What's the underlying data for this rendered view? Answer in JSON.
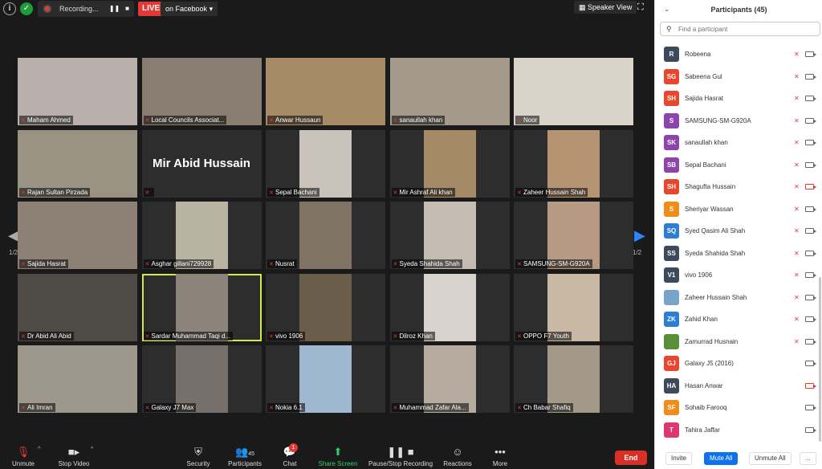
{
  "topbar": {
    "recording_label": "Recording...",
    "live_label": "LIVE",
    "live_target": "on Facebook",
    "speaker_view": "Speaker View"
  },
  "grid": {
    "page_indicator": "1/2",
    "big_name": "Mir Abid Hussain",
    "tiles": [
      {
        "name": "Maham Ahmed",
        "bg": "#b9b0ad"
      },
      {
        "name": "Local Councils Associat...",
        "bg": "#8a7d72"
      },
      {
        "name": "Anwar Hussaun",
        "bg": "#a78a66"
      },
      {
        "name": "sanaullah khan",
        "bg": "#a49a8c"
      },
      {
        "name": "Noor",
        "bg": "#d9d3c9"
      },
      {
        "name": "Rajan Sultan Pirzada",
        "bg": "#9a9384"
      },
      {
        "name": "",
        "bg": "#262626"
      },
      {
        "name": "Sepal Bachani",
        "bg": "#c9c3bc"
      },
      {
        "name": "Mir Ashraf Ali khan",
        "bg": "#a58a68"
      },
      {
        "name": "Zaheer Hussain Shah",
        "bg": "#b59474"
      },
      {
        "name": "Sajida Hasrat",
        "bg": "#8d8175"
      },
      {
        "name": "Asghar gillani729928",
        "bg": "#b9b3a4"
      },
      {
        "name": "Nusrat",
        "bg": "#7f7464"
      },
      {
        "name": "Syeda Shahida Shah",
        "bg": "#c5bcb1"
      },
      {
        "name": "SAMSUNG-SM-G920A",
        "bg": "#b79a84"
      },
      {
        "name": "Dr Abid Ali Abid",
        "bg": "#4e4a46"
      },
      {
        "name": "Sardar Muhammad Taqi d...",
        "bg": "#8c847a"
      },
      {
        "name": "vivo 1906",
        "bg": "#6a5d4a"
      },
      {
        "name": "Dilroz Khan",
        "bg": "#d8d3cc"
      },
      {
        "name": "OPPO F7 Youth",
        "bg": "#c9b8a4"
      },
      {
        "name": "Ali Imran",
        "bg": "#9e978c"
      },
      {
        "name": "Galaxy J7 Max",
        "bg": "#77706a"
      },
      {
        "name": "Nokia 6.1",
        "bg": "#9fb7cf"
      },
      {
        "name": "Muhammad Zafar Ala...",
        "bg": "#b6ab9f"
      },
      {
        "name": "Ch Babar Shafiq",
        "bg": "#a39989"
      }
    ]
  },
  "toolbar": {
    "unmute": "Unmute",
    "stop_video": "Stop Video",
    "security": "Security",
    "participants": "Participants",
    "participants_count": "45",
    "chat": "Chat",
    "chat_badge": "1",
    "share_screen": "Share Screen",
    "pause_stop_recording": "Pause/Stop Recording",
    "reactions": "Reactions",
    "more": "More",
    "end": "End"
  },
  "panel": {
    "title": "Participants (45)",
    "search_placeholder": "Find a participant",
    "invite": "Invite",
    "mute_all": "Mute All",
    "unmute_all": "Unmute All",
    "more": "...",
    "participants": [
      {
        "initials": "R",
        "name": "Robeena",
        "color": "#3c4a5c",
        "muted": true,
        "video_off": false
      },
      {
        "initials": "SG",
        "name": "Sabeena Gul",
        "color": "#e8472d",
        "muted": true,
        "video_off": false
      },
      {
        "initials": "SH",
        "name": "Sajida Hasrat",
        "color": "#e8472d",
        "muted": true,
        "video_off": false
      },
      {
        "initials": "S",
        "name": "SAMSUNG-SM-G920A",
        "color": "#8e44ad",
        "muted": true,
        "video_off": false
      },
      {
        "initials": "SK",
        "name": "sanaullah khan",
        "color": "#8e44ad",
        "muted": true,
        "video_off": false
      },
      {
        "initials": "SB",
        "name": "Sepal Bachani",
        "color": "#8e44ad",
        "muted": true,
        "video_off": false
      },
      {
        "initials": "SH",
        "name": "Shagufta Hussain",
        "color": "#e8472d",
        "muted": true,
        "video_off": true
      },
      {
        "initials": "S",
        "name": "Sheriyar Wassan",
        "color": "#f08c1a",
        "muted": true,
        "video_off": false
      },
      {
        "initials": "SQ",
        "name": "Syed Qasim Ali Shah",
        "color": "#2d7dd2",
        "muted": true,
        "video_off": false
      },
      {
        "initials": "SS",
        "name": "Syeda Shahida Shah",
        "color": "#3c4a5c",
        "muted": true,
        "video_off": false
      },
      {
        "initials": "V1",
        "name": "vivo 1906",
        "color": "#3c4a5c",
        "muted": true,
        "video_off": false
      },
      {
        "initials": "",
        "name": "Zaheer Hussain Shah",
        "color": "#7aa3c9",
        "muted": true,
        "video_off": false
      },
      {
        "initials": "ZK",
        "name": "Zahid Khan",
        "color": "#2d7dd2",
        "muted": true,
        "video_off": false
      },
      {
        "initials": "",
        "name": "Zamurrad Husnain",
        "color": "#5a8f3a",
        "muted": true,
        "video_off": false
      },
      {
        "initials": "GJ",
        "name": "Galaxy J5 (2016)",
        "color": "#e8472d",
        "muted": false,
        "video_off": false
      },
      {
        "initials": "HA",
        "name": "Hasan Anwar",
        "color": "#3c4a5c",
        "muted": false,
        "video_off": true
      },
      {
        "initials": "SF",
        "name": "Sohaib Farooq",
        "color": "#f08c1a",
        "muted": false,
        "video_off": false
      },
      {
        "initials": "T",
        "name": "Tahira Jaffar",
        "color": "#e0356e",
        "muted": false,
        "video_off": false
      }
    ]
  }
}
